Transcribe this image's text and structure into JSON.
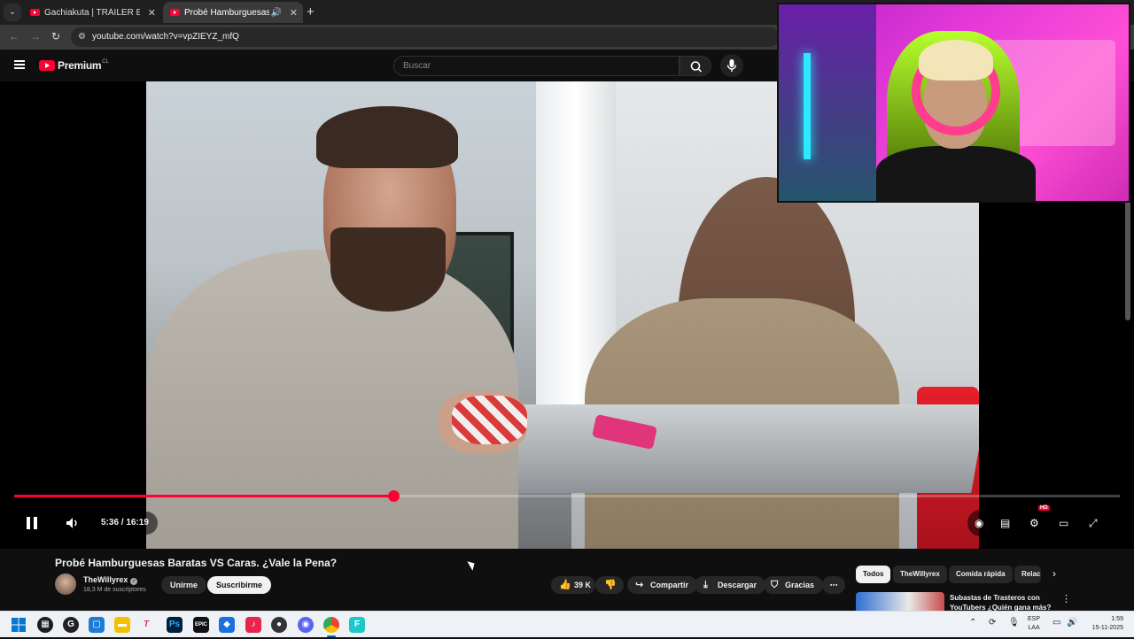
{
  "browser": {
    "tabs": [
      {
        "label": "Gachiakuta | TRÁILER EN ESPAÑOL",
        "active": false
      },
      {
        "label": "Probé Hamburguesas Baratas VS Caras",
        "active": true,
        "audio_icon": "speaker-icon"
      }
    ],
    "new_tab_icon": "plus-icon",
    "url": "youtube.com/watch?v=vpZIEYZ_mfQ"
  },
  "youtube_header": {
    "logo_text": "Premium",
    "logo_badge": "CL",
    "search_placeholder": "Buscar",
    "search_icon": "search-icon",
    "mic_icon": "microphone-icon"
  },
  "player": {
    "time_text": "5:36 / 16:19",
    "progress_fraction": 0.343,
    "hd_badge": "HD",
    "state": "playing",
    "accent_color": "#ff0033"
  },
  "video": {
    "title": "Probé Hamburguesas Baratas VS Caras. ¿Vale la Pena?",
    "channel_name": "TheWillyrex",
    "subscribers": "18,3 M de suscriptores",
    "join_label": "Unirme",
    "subscribe_label": "Suscribirme",
    "likes": "39 K",
    "share_label": "Compartir",
    "download_label": "Descargar",
    "thanks_label": "Gracias"
  },
  "sidebar": {
    "chips": [
      "Todos",
      "TheWillyrex",
      "Comida rápida",
      "Relac"
    ],
    "rec_title": "Subastas de Trasteros con YouTubers ¿Quién gana más?"
  },
  "taskbar": {
    "language": "ESP",
    "language_sub": "LAA",
    "time": "1:59",
    "date": "15-11-2025"
  }
}
